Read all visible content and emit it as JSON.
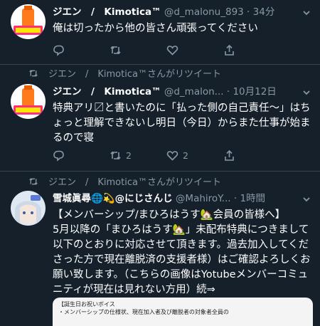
{
  "tweets": [
    {
      "name": "ジエン　/　Kimotica™",
      "handle": "@d_malonu_893",
      "dot": "·",
      "time": "34分",
      "text": "俺は切ったから他の皆さん頑張ってください",
      "retweet_count": "",
      "like_count": ""
    },
    {
      "retweeted_by": "ジエン　/　Kimotica™さんがリツイート",
      "name": "ジエン　/　Kimotica™",
      "handle": "@d_malon...",
      "dot": "·",
      "time": "10月12日",
      "text": "特典アリ〼と書いたのに「払った側の自己責任〜」はちょっと理解できないし明日（今日）からまた仕事が始まるので寝",
      "retweet_count": "2",
      "like_count": "2"
    },
    {
      "retweeted_by": "ジエン　/　Kimotica™さんがリツイート",
      "name": "雪城眞尋🌐💫@にじさんじ",
      "handle": "@MahiroY...",
      "dot": "·",
      "time": "1時間",
      "text": "【メンバーシップ/まひろはうす🏡会員の皆様へ】\n5月以降の「まひろはうす🏡」未配布特典につきまして以下のとおりに対応させて頂きます。過去加入してくださった方で現在離脱済の支援者様）はご確認よろしくお願い致します。（こちらの画像はYotubeメンバーコミュニティが現在は見れない方用）続⇒",
      "image_lines": [
        "【誕生日お祝いボイス",
        "・メンバーシップの仕様状、現在加入者及び離脱者の対象者全員の"
      ]
    }
  ],
  "colors": {
    "background": "#15202b",
    "text": "#ffffff",
    "muted": "#8899a6",
    "divider": "#38444d"
  }
}
